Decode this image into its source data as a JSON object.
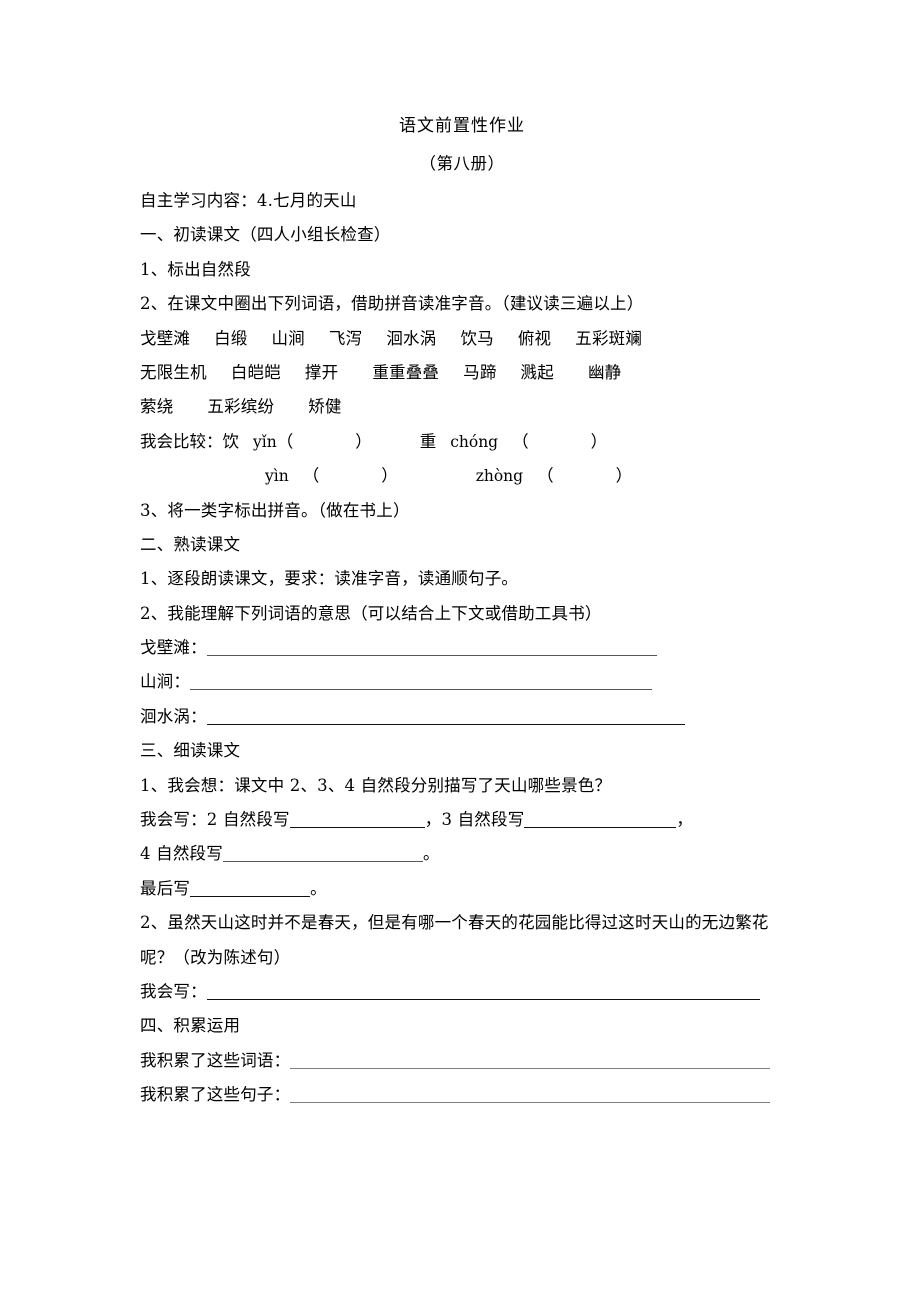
{
  "document": {
    "title": "语文前置性作业",
    "subtitle": "（第八册）",
    "lesson_line": "自主学习内容：4.七月的天山"
  },
  "section_one": {
    "heading": "一、初读课文（四人小组长检查）",
    "item1": "1、标出自然段",
    "item2": "2、在课文中圈出下列词语，借助拼音读准字音。（建议读三遍以上）",
    "words_row1": [
      "戈壁滩",
      "白缎",
      "山涧",
      "飞泻",
      "洄水涡",
      "饮马",
      "俯视",
      "五彩斑斓"
    ],
    "words_row2": [
      "无限生机",
      "白皑皑",
      "撑开",
      "重重叠叠",
      "马蹄",
      "溅起",
      "幽静"
    ],
    "words_row3": [
      "萦绕",
      "五彩缤纷",
      "矫健"
    ],
    "compare_label": "我会比较：",
    "compare": {
      "char1": "饮",
      "char1_pinyin_a": "yǐn",
      "char1_pinyin_b": "yìn",
      "char2": "重",
      "char2_pinyin_a": "chóng",
      "char2_pinyin_b": "zhòng",
      "paren_open": "（",
      "paren_close": "）"
    },
    "item3": "3、将一类字标出拼音。（做在书上）"
  },
  "section_two": {
    "heading": "二、熟读课文",
    "item1": "1、逐段朗读课文，要求：读准字音，读通顺句子。",
    "item2": "2、我能理解下列词语的意思（可以结合上下文或借助工具书）",
    "definitions": [
      {
        "term": "戈壁滩："
      },
      {
        "term": "山涧："
      },
      {
        "term": "洄水涡："
      }
    ]
  },
  "section_three": {
    "heading": "三、细读课文",
    "q1": "1、我会想：课文中 2、3、4 自然段分别描写了天山哪些景色？",
    "a1_prefix": "我会写：2 自然段写",
    "a1_mid": "，3 自然段写",
    "a1_end": "，",
    "a1_line2_prefix": "4 自然段写",
    "a1_line2_end": "。",
    "a1_line3_prefix": "最后写",
    "a1_line3_end": "。",
    "q2": "2、虽然天山这时并不是春天，但是有哪一个春天的花园能比得过这时天山的无边繁花呢？（改为陈述句）",
    "a2_label": "我会写："
  },
  "section_four": {
    "heading": "四、积累运用",
    "item1": "我积累了这些词语：",
    "item2": "我积累了这些句子："
  }
}
